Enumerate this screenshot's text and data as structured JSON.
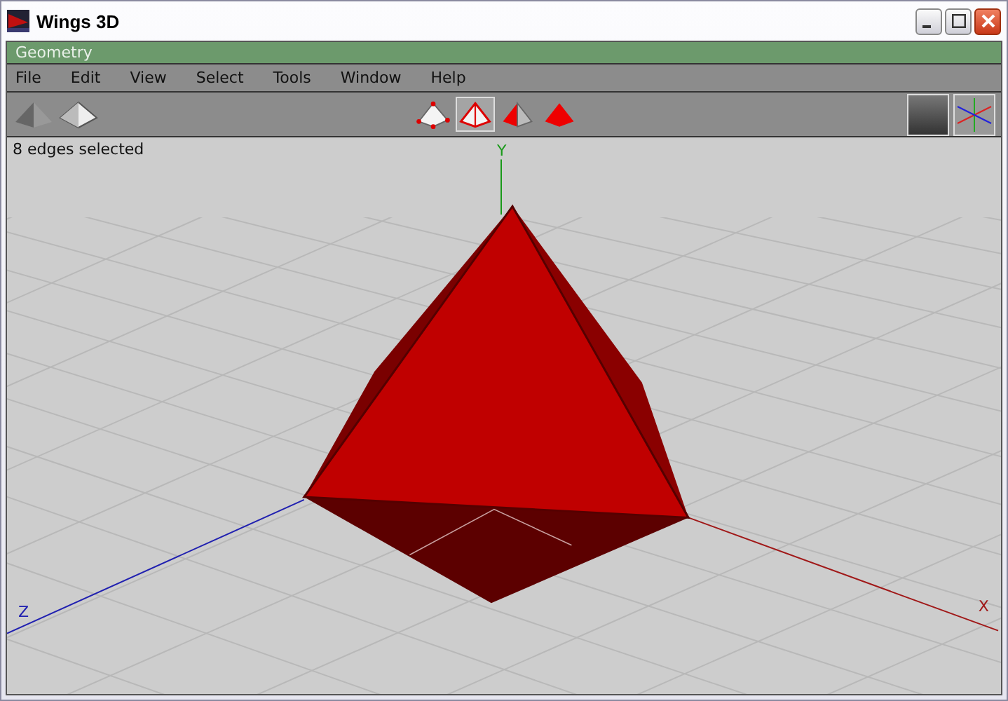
{
  "window": {
    "title": "Wings 3D"
  },
  "panel": {
    "title": "Geometry"
  },
  "menu": [
    "File",
    "Edit",
    "View",
    "Select",
    "Tools",
    "Window",
    "Help"
  ],
  "select_modes": [
    {
      "kind": "vertex",
      "selected": false
    },
    {
      "kind": "edge",
      "selected": true
    },
    {
      "kind": "face",
      "selected": false
    },
    {
      "kind": "body",
      "selected": false
    }
  ],
  "status": "8 edges selected",
  "axes": [
    {
      "kind": "y",
      "label": "Y"
    },
    {
      "kind": "z",
      "label": "Z"
    },
    {
      "kind": "x",
      "label": "X"
    }
  ]
}
